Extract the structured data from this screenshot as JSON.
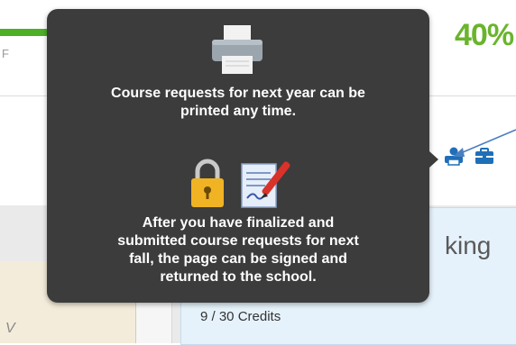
{
  "progress": {
    "fraction": 0.4,
    "percent_label": "40%",
    "tick_label": "F"
  },
  "tooltip": {
    "message_print": "Course requests for next year can be printed any time.",
    "message_sign": "After you have finalized and submitted course requests for next fall, the page can be signed and returned to the school.",
    "icons": [
      "printer-icon",
      "lock-icon",
      "sign-document-icon"
    ]
  },
  "toolbar": {
    "icons": [
      "printer-icon",
      "briefcase-icon"
    ]
  },
  "course_panel": {
    "title_fragment": "king",
    "credits": "9 / 30 Credits",
    "left_letter": "V"
  },
  "colors": {
    "tooltip_bg": "#3c3c3c",
    "progress": "#4caf26",
    "percent": "#6ab42d",
    "icon_blue": "#1f6fb8",
    "card_bg": "#e6f2fb"
  }
}
